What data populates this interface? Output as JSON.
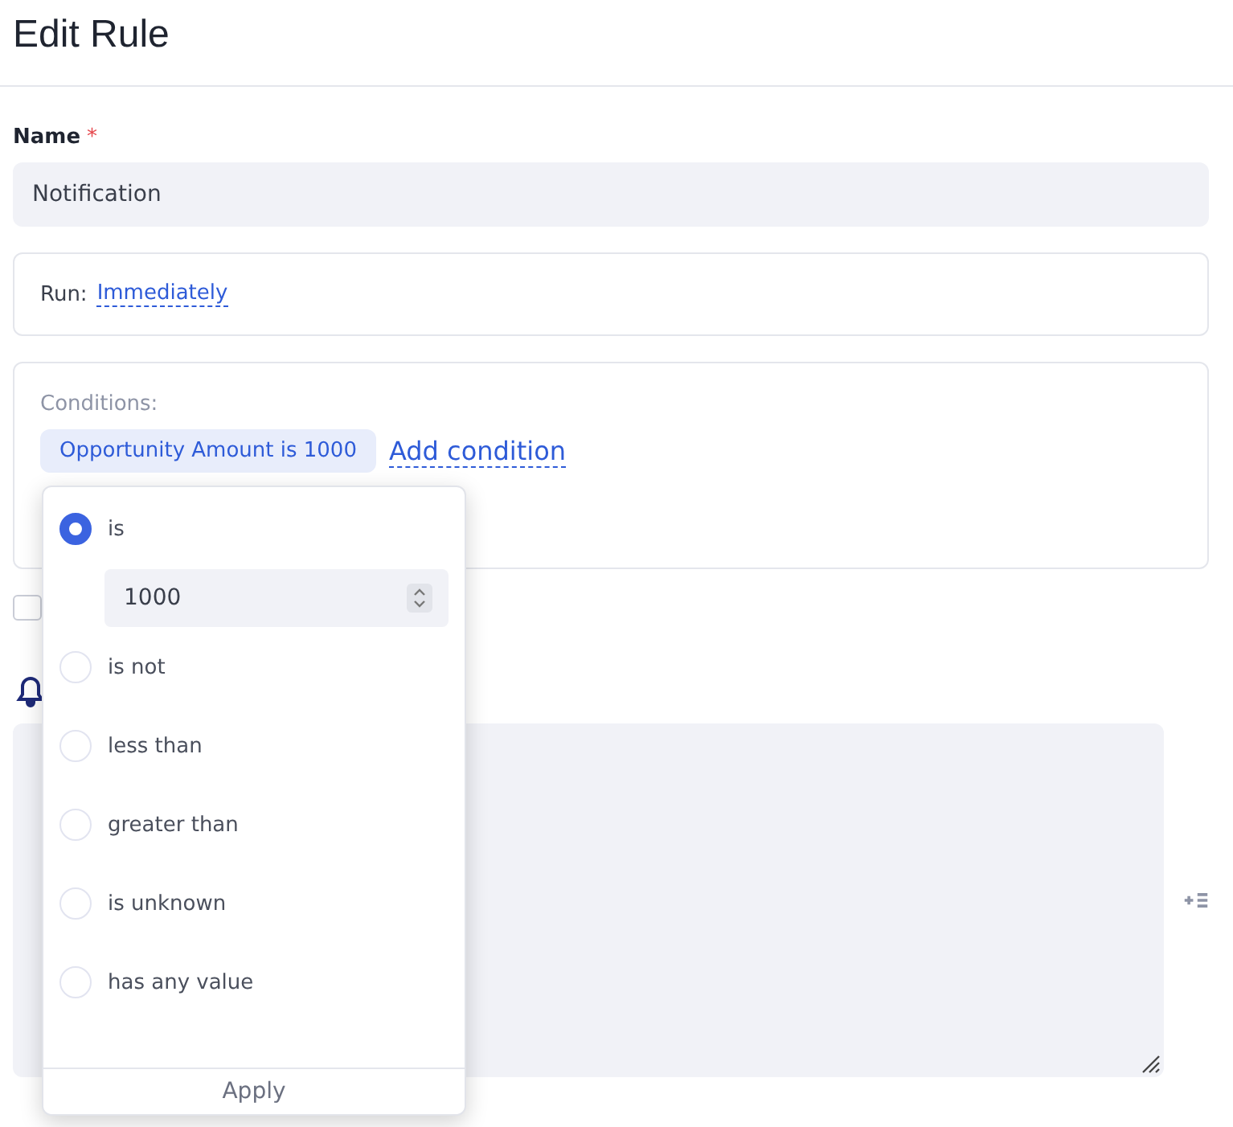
{
  "title": "Edit Rule",
  "name_field": {
    "label": "Name",
    "required_mark": "*",
    "value": "Notification"
  },
  "run": {
    "label": "Run:",
    "value": "Immediately"
  },
  "conditions": {
    "label": "Conditions:",
    "chip": "Opportunity Amount is 1000",
    "add_link": "Add condition"
  },
  "checkbox": {
    "checked": false
  },
  "popup": {
    "options": [
      {
        "label": "is",
        "selected": true,
        "value": "1000"
      },
      {
        "label": "is not",
        "selected": false
      },
      {
        "label": "less than",
        "selected": false
      },
      {
        "label": "greater than",
        "selected": false
      },
      {
        "label": "is unknown",
        "selected": false
      },
      {
        "label": "has any value",
        "selected": false
      }
    ],
    "apply": "Apply"
  }
}
